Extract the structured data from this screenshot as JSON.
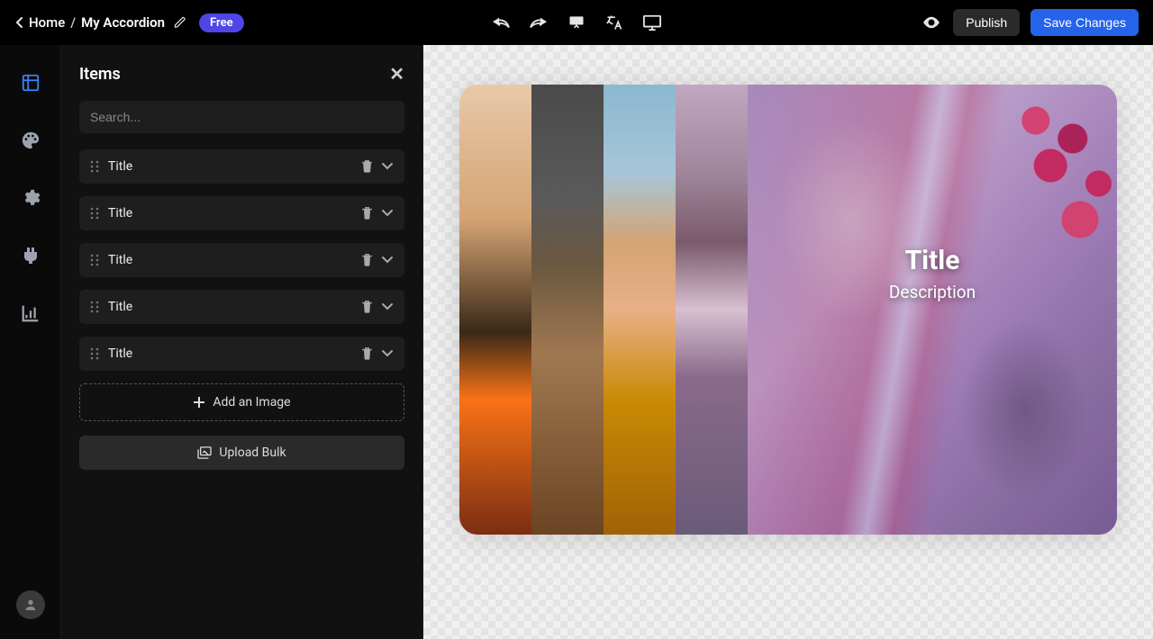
{
  "breadcrumb": {
    "home": "Home",
    "current": "My Accordion"
  },
  "badge": "Free",
  "buttons": {
    "publish": "Publish",
    "save": "Save Changes"
  },
  "panel": {
    "title": "Items",
    "search_placeholder": "Search...",
    "items": [
      {
        "label": "Title"
      },
      {
        "label": "Title"
      },
      {
        "label": "Title"
      },
      {
        "label": "Title"
      },
      {
        "label": "Title"
      }
    ],
    "add_image": "Add an Image",
    "upload_bulk": "Upload Bulk"
  },
  "preview": {
    "title": "Title",
    "description": "Description"
  }
}
